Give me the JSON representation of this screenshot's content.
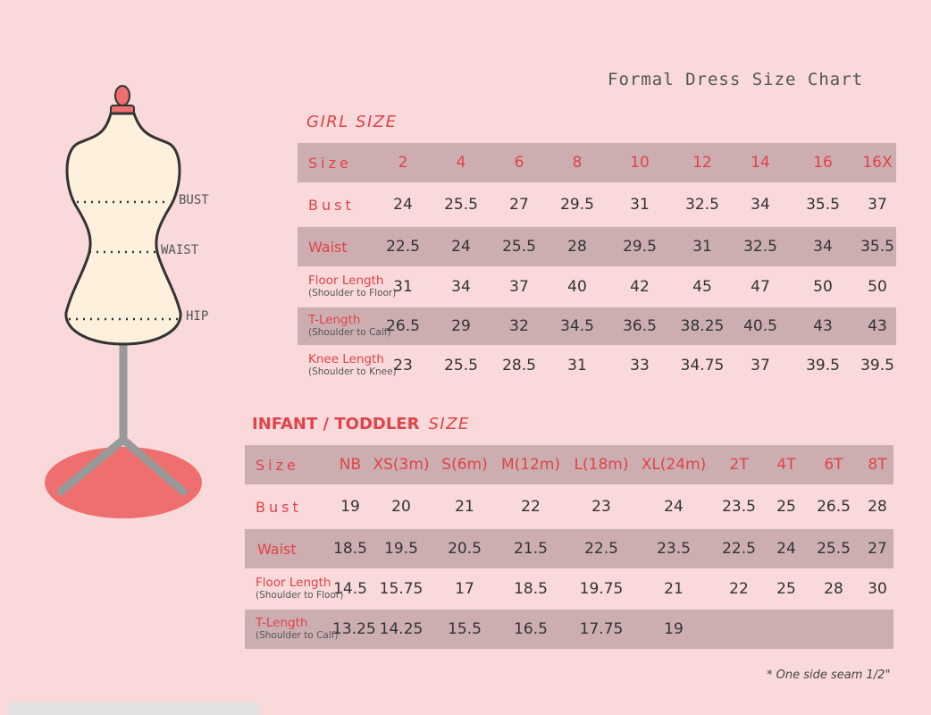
{
  "title": "Formal Dress Size Chart",
  "colors": {
    "background": "#f9d9da",
    "accent": "#e0434a",
    "band": "#ccaeb0",
    "form": "#fdf0dc",
    "stand": "#999999",
    "base": "#ef6e6e"
  },
  "mannequin": {
    "labels": {
      "bust": "BUST",
      "waist": "WAIST",
      "hip": "HIP"
    }
  },
  "girl": {
    "title": "GIRL SIZE",
    "header": {
      "label": "Size",
      "sizes": [
        "2",
        "4",
        "6",
        "8",
        "10",
        "12",
        "14",
        "16",
        "16X"
      ]
    },
    "rows": [
      {
        "label": "Bust",
        "values": [
          "24",
          "25.5",
          "27",
          "29.5",
          "31",
          "32.5",
          "34",
          "35.5",
          "37"
        ]
      },
      {
        "label": "Waist",
        "values": [
          "22.5",
          "24",
          "25.5",
          "28",
          "29.5",
          "31",
          "32.5",
          "34",
          "35.5"
        ]
      },
      {
        "label": "Floor Length",
        "sub": "(Shoulder to Floor)",
        "values": [
          "31",
          "34",
          "37",
          "40",
          "42",
          "45",
          "47",
          "50",
          "50"
        ]
      },
      {
        "label": "T-Length",
        "sub": "(Shoulder to Calf)",
        "values": [
          "26.5",
          "29",
          "32",
          "34.5",
          "36.5",
          "38.25",
          "40.5",
          "43",
          "43"
        ]
      },
      {
        "label": "Knee Length",
        "sub": "(Shoulder to Knee)",
        "values": [
          "23",
          "25.5",
          "28.5",
          "31",
          "33",
          "34.75",
          "37",
          "39.5",
          "39.5"
        ]
      }
    ]
  },
  "infant": {
    "title_bold": "INFANT / TODDLER",
    "title_italic": "SIZE",
    "header": {
      "label": "Size",
      "sizes": [
        "NB",
        "XS(3m)",
        "S(6m)",
        "M(12m)",
        "L(18m)",
        "XL(24m)",
        "2T",
        "4T",
        "6T",
        "8T"
      ]
    },
    "rows": [
      {
        "label": "Bust",
        "values": [
          "19",
          "20",
          "21",
          "22",
          "23",
          "24",
          "23.5",
          "25",
          "26.5",
          "28"
        ]
      },
      {
        "label": "Waist",
        "values": [
          "18.5",
          "19.5",
          "20.5",
          "21.5",
          "22.5",
          "23.5",
          "22.5",
          "24",
          "25.5",
          "27"
        ]
      },
      {
        "label": "Floor Length",
        "sub": "(Shoulder to Floor)",
        "values": [
          "14.5",
          "15.75",
          "17",
          "18.5",
          "19.75",
          "21",
          "22",
          "25",
          "28",
          "30"
        ]
      },
      {
        "label": "T-Length",
        "sub": "(Shoulder to Calf)",
        "values": [
          "13.25",
          "14.25",
          "15.5",
          "16.5",
          "17.75",
          "19",
          "",
          "",
          "",
          ""
        ]
      }
    ]
  },
  "note": "* One side seam 1/2\""
}
